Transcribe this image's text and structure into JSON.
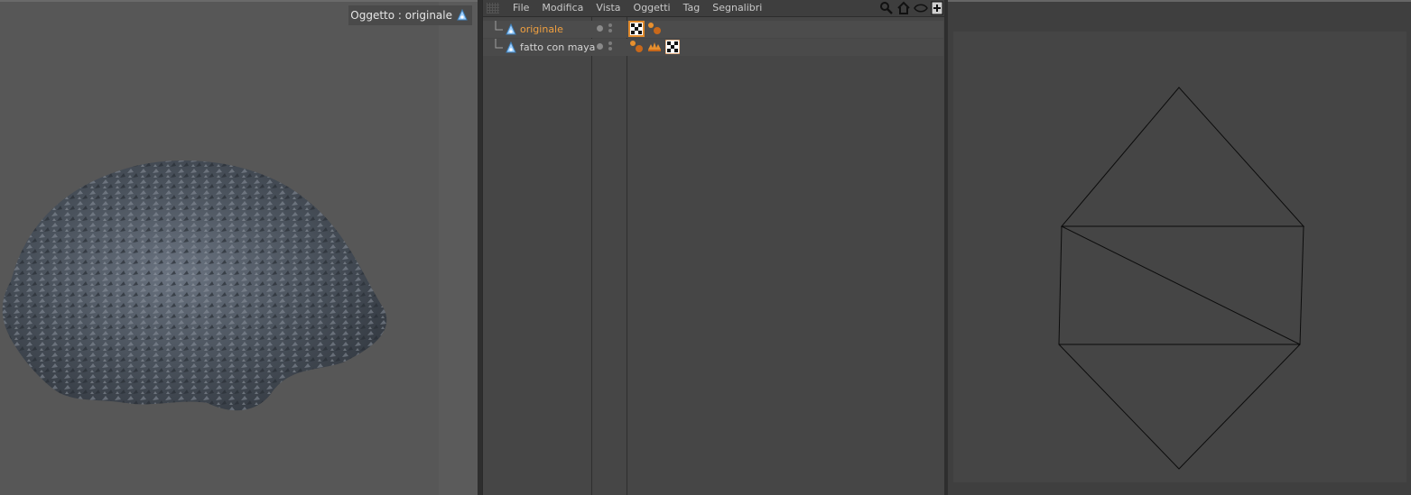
{
  "viewport_left": {
    "object_label": "Oggetto : originale"
  },
  "object_manager": {
    "menu": [
      "File",
      "Modifica",
      "Vista",
      "Oggetti",
      "Tag",
      "Segnalibri"
    ],
    "tool_icons": [
      "search-icon",
      "home-icon",
      "eye-icon",
      "new-window-icon"
    ],
    "objects": [
      {
        "name": "originale",
        "active": true,
        "tags": [
          "material-tag",
          "texture-tag"
        ]
      },
      {
        "name": "fatto con maya",
        "active": false,
        "tags": [
          "texture-tag",
          "display-tag",
          "material-tag"
        ]
      }
    ]
  },
  "colors": {
    "accent_orange": "#f0a040",
    "viewport_bg": "#575757",
    "panel_bg": "#464646"
  }
}
